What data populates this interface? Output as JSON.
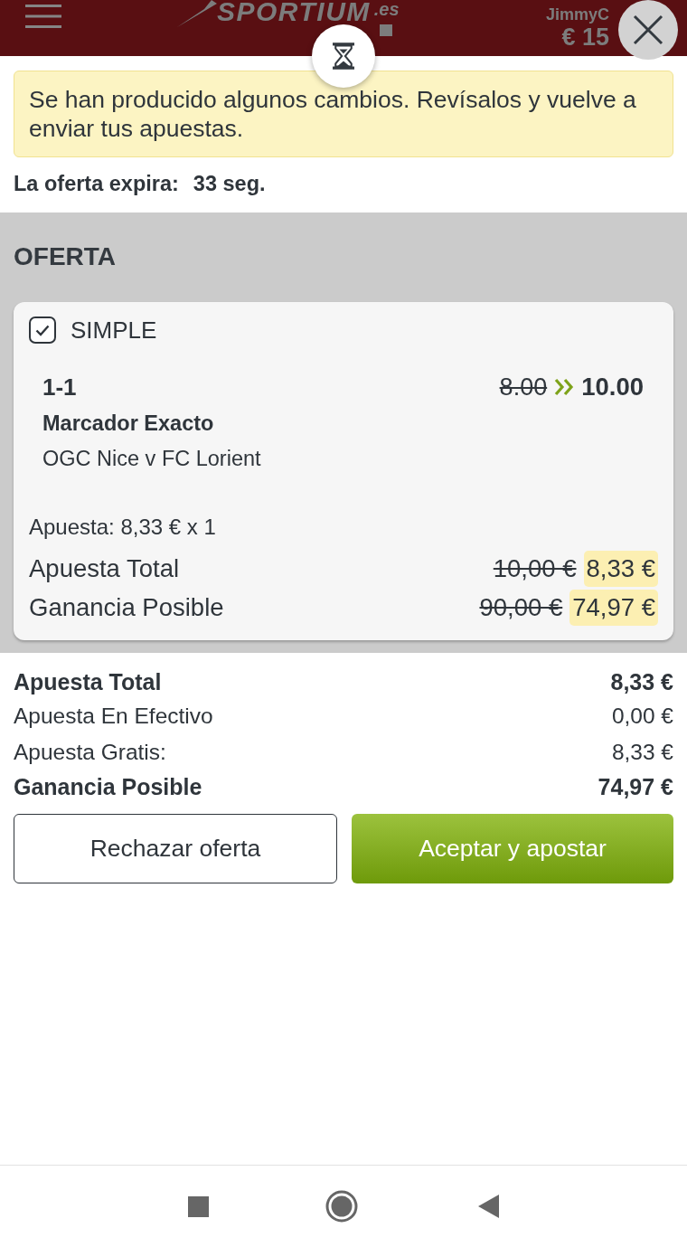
{
  "header": {
    "logo": "SPORTIUM",
    "logo_domain": ".es",
    "username": "JimmyC",
    "balance": "€ 15"
  },
  "alert": {
    "text": "Se han producido algunos cambios. Revísalos y vuelve a enviar tus apuestas."
  },
  "expiry": {
    "label": "La oferta expira:",
    "value": "33 seg."
  },
  "offer": {
    "title": "OFERTA",
    "bets": [
      {
        "checked": true,
        "type": "SIMPLE",
        "selection": "1-1",
        "market": "Marcador Exacto",
        "event": "OGC Nice v FC Lorient",
        "old_odds": "8.00",
        "new_odds": "10.00",
        "stake": "Apuesta: 8,33 € x 1",
        "totals": [
          {
            "label": "Apuesta Total",
            "old_value": "10,00 €",
            "new_value": "8,33 €"
          },
          {
            "label": "Ganancia Posible",
            "old_value": "90,00 €",
            "new_value": "74,97 €"
          }
        ]
      }
    ]
  },
  "summary": [
    {
      "label": "Apuesta Total",
      "value": "8,33 €",
      "emphasis": true
    },
    {
      "label": "Apuesta En Efectivo",
      "value": "0,00 €",
      "emphasis": false
    },
    {
      "label": "Apuesta Gratis:",
      "value": "8,33 €",
      "emphasis": false
    },
    {
      "label": "Ganancia Posible",
      "value": "74,97 €",
      "emphasis": true
    }
  ],
  "buttons": [
    {
      "label": "Rechazar oferta",
      "kind": "outline"
    },
    {
      "label": "Aceptar y apostar",
      "kind": "primary"
    }
  ]
}
